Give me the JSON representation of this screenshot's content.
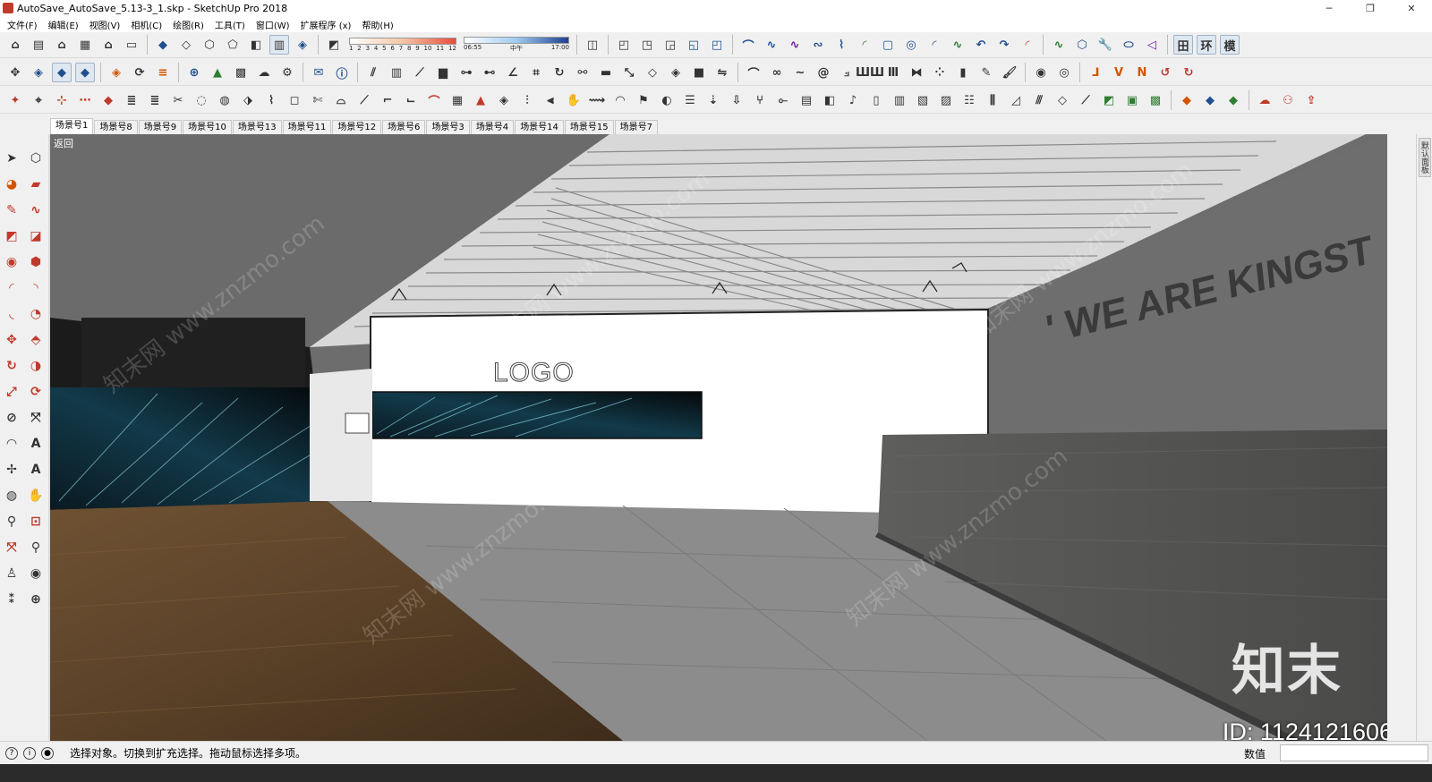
{
  "window": {
    "title": "AutoSave_AutoSave_5.13-3_1.skp - SketchUp Pro 2018",
    "minimize": "─",
    "maximize": "❐",
    "close": "✕"
  },
  "menu": [
    "文件(F)",
    "编辑(E)",
    "视图(V)",
    "相机(C)",
    "绘图(R)",
    "工具(T)",
    "窗口(W)",
    "扩展程序 (x)",
    "帮助(H)"
  ],
  "shadow_widget": {
    "months": [
      "1",
      "2",
      "3",
      "4",
      "5",
      "6",
      "7",
      "8",
      "9",
      "10",
      "11",
      "12"
    ],
    "time_start": "06:55",
    "time_mid": "中午",
    "time_end": "17:00"
  },
  "toolbar_text": {
    "grid_icon": "田",
    "env_icon": "环",
    "model_icon": "模"
  },
  "scenes": [
    "场景号1",
    "场景号8",
    "场景号9",
    "场景号10",
    "场景号13",
    "场景号11",
    "场景号12",
    "场景号6",
    "场景号3",
    "场景号4",
    "场景号14",
    "场景号15",
    "场景号7"
  ],
  "active_scene": "场景号1",
  "viewport": {
    "return_label": "返回",
    "logo": "LOGO",
    "slogan": "' WE ARE KINGST",
    "watermark_brand": "知末",
    "watermark_id": "ID: 1124121606",
    "watermark_diag": "知末网 www.znzmo.com"
  },
  "right_dock": {
    "tab_label": "默认面板"
  },
  "status": {
    "message": "选择对象。切换到扩充选择。拖动鼠标选择多项。",
    "measure_label": "数值",
    "measure_value": ""
  }
}
